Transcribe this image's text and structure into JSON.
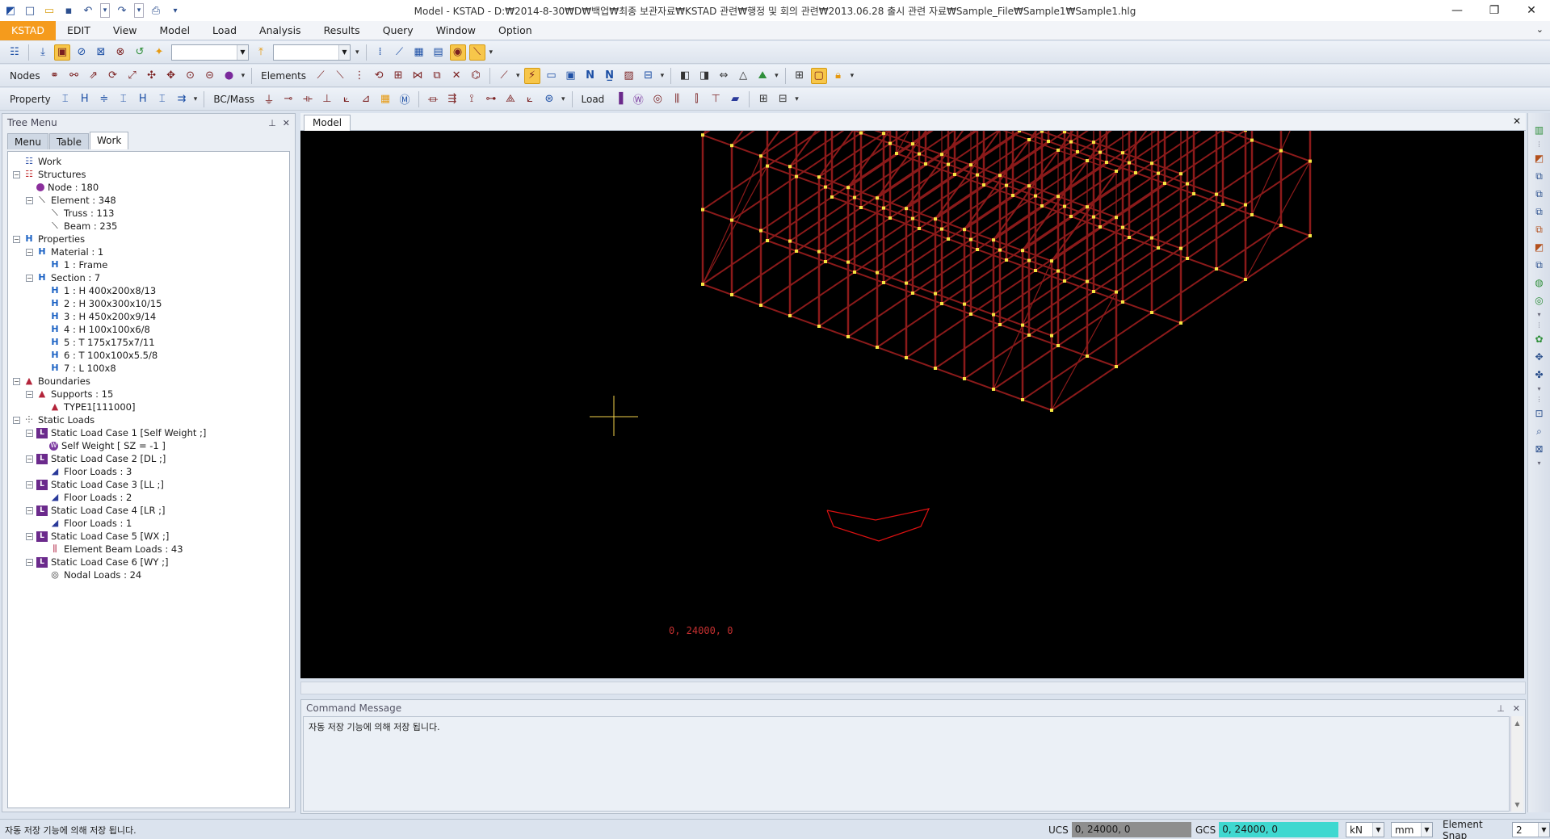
{
  "window": {
    "title": "Model - KSTAD - D:₩2014-8-30₩D₩백업₩최종 보관자료₩KSTAD 관련₩행정 및 회의 관련₩2013.06.28 출시 관련 자료₩Sample_File₩Sample1₩Sample1.hlg",
    "minimize": "—",
    "restore": "❐",
    "close": "✕"
  },
  "quick_access": {
    "app_icon": "app-logo-icon",
    "new": "□",
    "open": "▭",
    "save": "▪",
    "undo": "↶",
    "redo": "↷",
    "print": "⎙",
    "more": "▾"
  },
  "menu": {
    "items": [
      "KSTAD",
      "EDIT",
      "View",
      "Model",
      "Load",
      "Analysis",
      "Results",
      "Query",
      "Window",
      "Option"
    ],
    "active_index": 0,
    "collapse_glyph": "⌄"
  },
  "toolbar2": {
    "labels": {
      "nodes": "Nodes",
      "elements": "Elements"
    }
  },
  "toolbar3": {
    "labels": {
      "property": "Property",
      "bc_mass": "BC/Mass",
      "load": "Load"
    }
  },
  "tree_panel": {
    "title": "Tree Menu",
    "pin": "⊥",
    "close": "✕",
    "tabs": [
      "Menu",
      "Table",
      "Work"
    ],
    "active_tab": 2,
    "nodes": [
      {
        "label": "Work",
        "level": 0,
        "icon": "work-icon",
        "exp": ""
      },
      {
        "label": "Structures",
        "level": 0,
        "icon": "structure-icon",
        "exp": "−"
      },
      {
        "label": "Node : 180",
        "level": 1,
        "icon": "node-icon",
        "exp": ""
      },
      {
        "label": "Element : 348",
        "level": 1,
        "icon": "element-icon",
        "exp": "−"
      },
      {
        "label": "Truss : 113",
        "level": 2,
        "icon": "truss-icon",
        "exp": ""
      },
      {
        "label": "Beam : 235",
        "level": 2,
        "icon": "beam-icon",
        "exp": ""
      },
      {
        "label": "Properties",
        "level": 0,
        "icon": "properties-icon",
        "exp": "−"
      },
      {
        "label": "Material : 1",
        "level": 1,
        "icon": "material-icon",
        "exp": "−"
      },
      {
        "label": "1 : Frame",
        "level": 2,
        "icon": "section-icon",
        "exp": ""
      },
      {
        "label": "Section : 7",
        "level": 1,
        "icon": "section-icon",
        "exp": "−"
      },
      {
        "label": "1 : H 400x200x8/13",
        "level": 2,
        "icon": "section-icon",
        "exp": ""
      },
      {
        "label": "2 : H 300x300x10/15",
        "level": 2,
        "icon": "section-icon",
        "exp": ""
      },
      {
        "label": "3 : H 450x200x9/14",
        "level": 2,
        "icon": "section-icon",
        "exp": ""
      },
      {
        "label": "4 : H 100x100x6/8",
        "level": 2,
        "icon": "section-icon",
        "exp": ""
      },
      {
        "label": "5 : T 175x175x7/11",
        "level": 2,
        "icon": "section-icon",
        "exp": ""
      },
      {
        "label": "6 : T 100x100x5.5/8",
        "level": 2,
        "icon": "section-icon",
        "exp": ""
      },
      {
        "label": "7 : L 100x8",
        "level": 2,
        "icon": "section-icon",
        "exp": ""
      },
      {
        "label": "Boundaries",
        "level": 0,
        "icon": "boundaries-icon",
        "exp": "−"
      },
      {
        "label": "Supports : 15",
        "level": 1,
        "icon": "support-icon",
        "exp": "−"
      },
      {
        "label": "TYPE1[111000]",
        "level": 2,
        "icon": "support-icon",
        "exp": ""
      },
      {
        "label": "Static Loads",
        "level": 0,
        "icon": "static-loads-icon",
        "exp": "−"
      },
      {
        "label": "Static Load Case 1 [Self Weight ;]",
        "level": 1,
        "icon": "load-case-icon",
        "exp": "−"
      },
      {
        "label": "Self Weight [ SZ = -1 ]",
        "level": 2,
        "icon": "self-weight-icon",
        "exp": ""
      },
      {
        "label": "Static Load Case 2 [DL ;]",
        "level": 1,
        "icon": "load-case-icon",
        "exp": "−"
      },
      {
        "label": "Floor Loads : 3",
        "level": 2,
        "icon": "floor-load-icon",
        "exp": ""
      },
      {
        "label": "Static Load Case 3 [LL ;]",
        "level": 1,
        "icon": "load-case-icon",
        "exp": "−"
      },
      {
        "label": "Floor Loads : 2",
        "level": 2,
        "icon": "floor-load-icon",
        "exp": ""
      },
      {
        "label": "Static Load Case 4 [LR ;]",
        "level": 1,
        "icon": "load-case-icon",
        "exp": "−"
      },
      {
        "label": "Floor Loads : 1",
        "level": 2,
        "icon": "floor-load-icon",
        "exp": ""
      },
      {
        "label": "Static Load Case 5 [WX ;]",
        "level": 1,
        "icon": "load-case-icon",
        "exp": "−"
      },
      {
        "label": "Element Beam Loads : 43",
        "level": 2,
        "icon": "element-beam-load-icon",
        "exp": ""
      },
      {
        "label": "Static Load Case 6 [WY ;]",
        "level": 1,
        "icon": "load-case-icon",
        "exp": "−"
      },
      {
        "label": "Nodal Loads : 24",
        "level": 2,
        "icon": "nodal-load-icon",
        "exp": ""
      }
    ]
  },
  "model_view": {
    "tab": "Model",
    "close": "✕",
    "coord_label": "0, 24000, 0",
    "background": "#000000",
    "frame_color": "#8b1a1a",
    "node_color": "#f5e642"
  },
  "command_panel": {
    "title": "Command Message",
    "pin": "⊥",
    "close": "✕",
    "message": "자동 저장 기능에 의해 저장 됩니다."
  },
  "status_bar": {
    "message": "자동 저장 기능에 의해 저장 됩니다.",
    "ucs_label": "UCS",
    "ucs_value": "0, 24000, 0",
    "gcs_label": "GCS",
    "gcs_value": "0, 24000, 0",
    "force_unit": "kN",
    "length_unit": "mm",
    "snap_label": "Element Snap",
    "snap_value": "2",
    "ucs_color": "#8e8e8e",
    "gcs_color": "#3fd8d0"
  }
}
